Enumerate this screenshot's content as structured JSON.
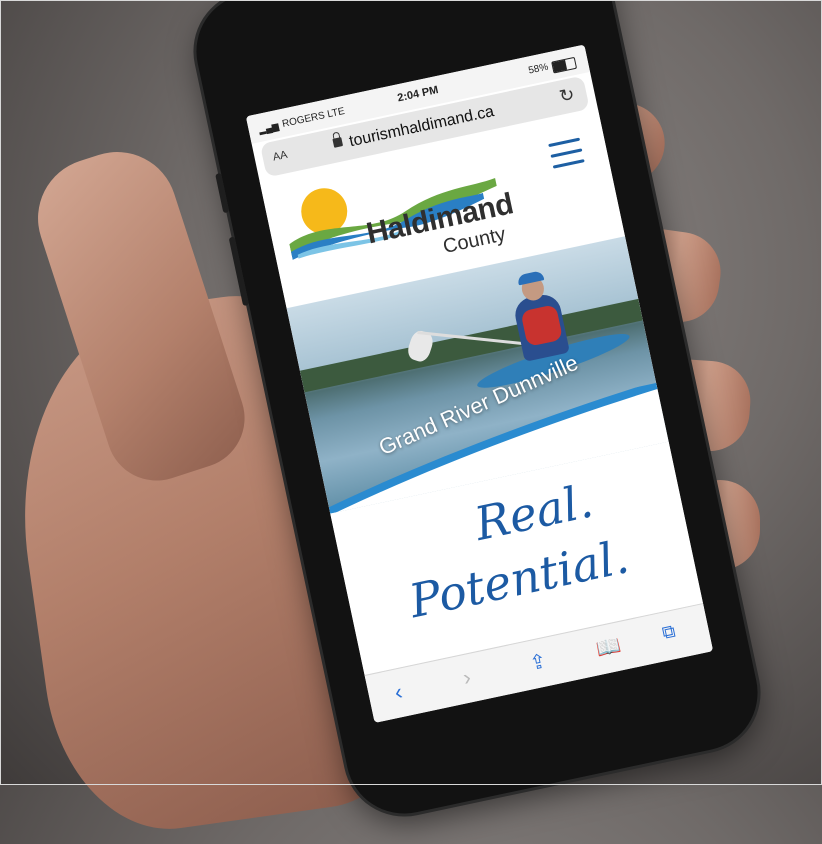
{
  "status_bar": {
    "carrier": "ROGERS",
    "network": "LTE",
    "time": "2:04 PM",
    "battery": "58%"
  },
  "url_bar": {
    "text_size_label": "AA",
    "url": "tourismhaldimand.ca"
  },
  "logo": {
    "name": "Haldimand",
    "county": "County"
  },
  "hero": {
    "caption": "Grand River Dunnville"
  },
  "slogan": {
    "line1": "Real.",
    "line2": "Potential."
  },
  "toolbar": {
    "back_icon": "‹",
    "forward_icon": "›",
    "share_icon": "⇪",
    "bookmarks_icon": "📖",
    "tabs_icon": "⧉"
  },
  "colors": {
    "brand_blue": "#1c5aa3",
    "sun_yellow": "#f6b91a",
    "wave_green": "#6aa842",
    "wave_blue": "#2a7fc4"
  }
}
